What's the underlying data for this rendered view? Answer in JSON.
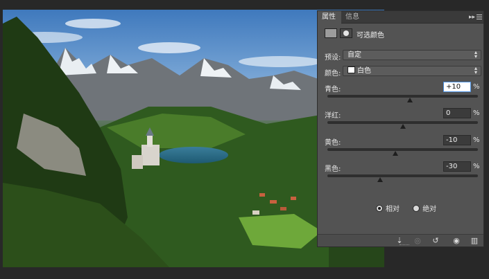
{
  "photo": {
    "subject": "mountain-castle-landscape"
  },
  "panel": {
    "tabs": [
      {
        "label": "属性"
      },
      {
        "label": "信息"
      }
    ],
    "collapse_label": "▸▸",
    "title": "可选颜色",
    "preset": {
      "label": "预设:",
      "value": "自定"
    },
    "colors": {
      "label": "颜色:",
      "value": "白色",
      "swatch": "#ffffff"
    },
    "sliders": [
      {
        "label": "青色:",
        "value": "+10",
        "percent": "%",
        "fraction": 0.55
      },
      {
        "label": "洋红:",
        "value": "0",
        "percent": "%",
        "fraction": 0.5
      },
      {
        "label": "黄色:",
        "value": "-10",
        "percent": "%",
        "fraction": 0.45
      },
      {
        "label": "黑色:",
        "value": "-30",
        "percent": "%",
        "fraction": 0.35
      }
    ],
    "method": {
      "relative": "相对",
      "absolute": "绝对",
      "selected": "relative"
    },
    "footer_icons": [
      "clip-to-layer-icon",
      "view-previous-icon",
      "reset-icon",
      "visibility-eye-icon",
      "trash-icon"
    ]
  }
}
